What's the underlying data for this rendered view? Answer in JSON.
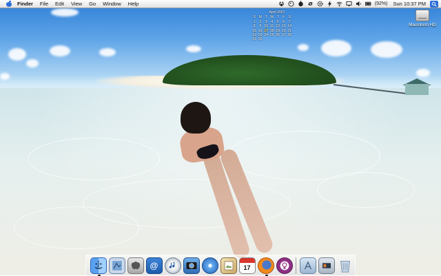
{
  "menubar": {
    "app_name": "Finder",
    "items": [
      "File",
      "Edit",
      "View",
      "Go",
      "Window",
      "Help"
    ],
    "battery": "(92%)",
    "clock": "Sun 10:37 PM"
  },
  "calendar": {
    "title": "April 2007",
    "weekdays": [
      "S",
      "M",
      "T",
      "W",
      "T",
      "F",
      "S"
    ],
    "weeks": [
      [
        "1",
        "2",
        "3",
        "4",
        "5",
        "6",
        "7"
      ],
      [
        "8",
        "9",
        "10",
        "11",
        "12",
        "13",
        "14"
      ],
      [
        "15",
        "16",
        "17",
        "18",
        "19",
        "20",
        "21"
      ],
      [
        "22",
        "23",
        "24",
        "25",
        "26",
        "27",
        "28"
      ],
      [
        "29",
        "30",
        "",
        "",
        "",
        "",
        ""
      ]
    ]
  },
  "desktop": {
    "disk_label": "Macintosh HD"
  },
  "dock": {
    "ical_day": "17",
    "icons": [
      "finder-icon",
      "mail-stamp-icon",
      "system-preferences-icon",
      "address-book-icon",
      "itunes-icon",
      "iphoto-icon",
      "dvd-player-icon",
      "preview-icon",
      "ical-icon",
      "firefox-icon",
      "adium-icon",
      "applications-folder-icon",
      "documents-folder-icon",
      "trash-icon"
    ]
  }
}
